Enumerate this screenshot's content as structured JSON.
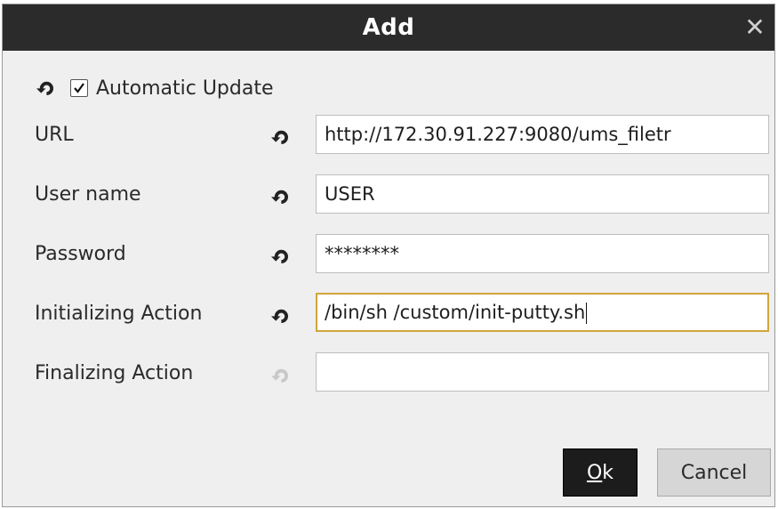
{
  "dialog": {
    "title": "Add",
    "close_icon": "close-icon"
  },
  "automatic_update": {
    "label": "Automatic Update",
    "checked": true,
    "reset_icon": "reset-icon"
  },
  "fields": [
    {
      "label": "URL",
      "value": "http://172.30.91.227:9080/ums_filetr",
      "reset_enabled": true,
      "focused": false
    },
    {
      "label": "User name",
      "value": "USER",
      "reset_enabled": true,
      "focused": false
    },
    {
      "label": "Password",
      "value": "********",
      "reset_enabled": true,
      "focused": false
    },
    {
      "label": "Initializing Action",
      "value": "/bin/sh /custom/init-putty.sh",
      "reset_enabled": true,
      "focused": true
    },
    {
      "label": "Finalizing Action",
      "value": "",
      "reset_enabled": false,
      "focused": false
    }
  ],
  "buttons": {
    "ok_mnemonic": "O",
    "ok_rest": "k",
    "cancel": "Cancel"
  },
  "colors": {
    "titlebar": "#2b2b2b",
    "focus_border": "#d0a63a",
    "reset_icon_enabled": "#222222",
    "reset_icon_disabled": "#c8c8c8"
  }
}
